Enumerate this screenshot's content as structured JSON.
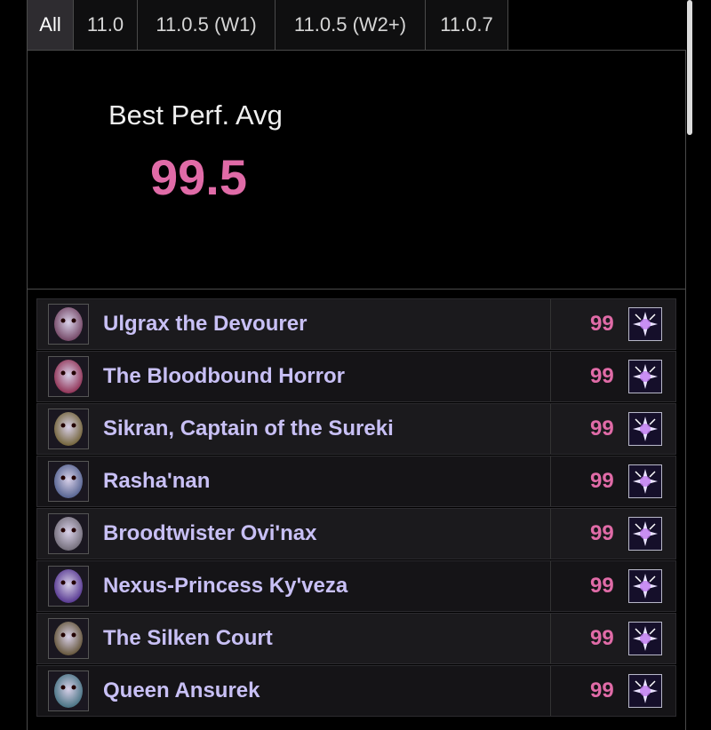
{
  "tabs": [
    {
      "label": "All",
      "active": true
    },
    {
      "label": "11.0",
      "active": false
    },
    {
      "label": "11.0.5 (W1)",
      "active": false
    },
    {
      "label": "11.0.5 (W2+)",
      "active": false
    },
    {
      "label": "11.0.7",
      "active": false
    }
  ],
  "summary": {
    "label": "Best Perf. Avg",
    "value": "99.5"
  },
  "bosses": [
    {
      "name": "Ulgrax the Devourer",
      "score": "99",
      "icon_color": "#6b3b5a"
    },
    {
      "name": "The Bloodbound Horror",
      "score": "99",
      "icon_color": "#8a2448"
    },
    {
      "name": "Sikran, Captain of the Sureki",
      "score": "99",
      "icon_color": "#6a5a2a"
    },
    {
      "name": "Rasha'nan",
      "score": "99",
      "icon_color": "#4a5a8a"
    },
    {
      "name": "Broodtwister Ovi'nax",
      "score": "99",
      "icon_color": "#6a6570"
    },
    {
      "name": "Nexus-Princess Ky'veza",
      "score": "99",
      "icon_color": "#4b2a8a"
    },
    {
      "name": "The Silken Court",
      "score": "99",
      "icon_color": "#5a4a2a"
    },
    {
      "name": "Queen Ansurek",
      "score": "99",
      "icon_color": "#3a6a7a"
    }
  ],
  "colors": {
    "accent": "#e06ba7",
    "boss_name": "#c8c0f5"
  },
  "icons": {
    "spec": "sparkle-icon"
  }
}
